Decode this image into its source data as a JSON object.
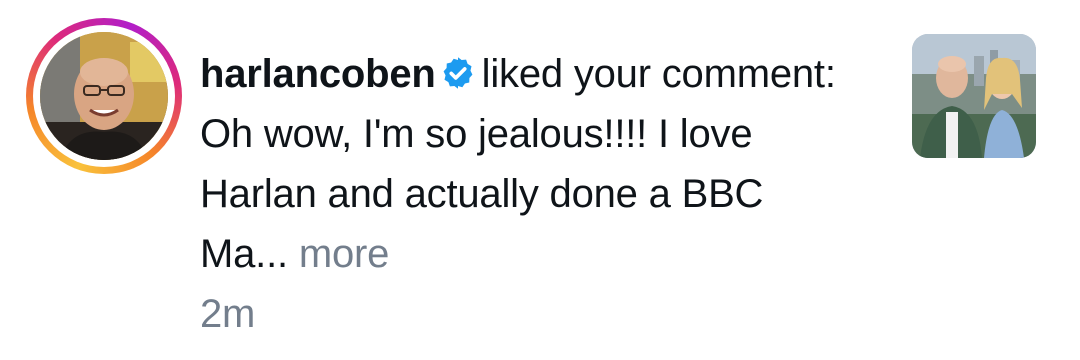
{
  "notification": {
    "username": "harlancoben",
    "verified": true,
    "action": "liked your comment:",
    "comment_excerpt": "Oh wow, I'm so jealous!!!! I love Harlan and actually done a BBC Ma...",
    "more_label": "more",
    "time": "2m"
  },
  "icons": {
    "verified": "verified-badge-icon",
    "avatar": "avatar",
    "thumbnail": "post-thumbnail"
  },
  "colors": {
    "verified_blue": "#1d9bf0",
    "muted_text": "#737e8c",
    "primary_text": "#0f1419",
    "ring_start": "#f9c23c",
    "ring_end": "#b11ec9"
  }
}
